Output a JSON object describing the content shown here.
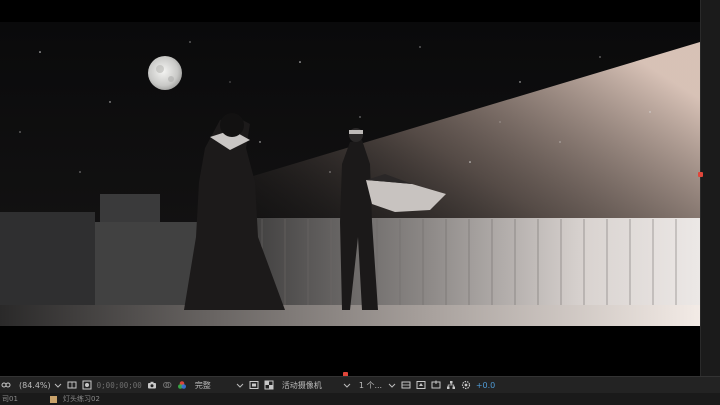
{
  "viewer": {
    "scene_description_visible": false
  },
  "toolbar": {
    "zoom_label": "(84.4%)",
    "timecode": "0;00;00;00",
    "resolution_label": "完整",
    "camera_label": "活动摄像机",
    "views_label": "1 个...",
    "exposure_value": "+0.0"
  },
  "panel_bar": {
    "left_label": "司01",
    "comp_tab_label": "灯头练习02"
  },
  "colors": {
    "marker_red": "#e0463a",
    "exposure_blue": "#4f9bd6",
    "toolbar_bg": "#232323"
  }
}
